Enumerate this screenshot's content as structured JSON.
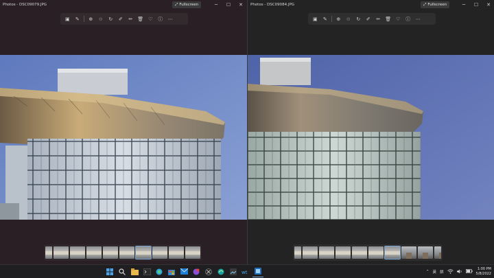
{
  "windows": [
    {
      "title": "Photos - DSC09079.JPG",
      "fullscreen_label": "Fullscreen"
    },
    {
      "title": "Photos - DSC09084.JPG",
      "fullscreen_label": "Fullscreen"
    }
  ],
  "toolbar_icons": [
    "gallery-icon",
    "edit-image-icon",
    "zoom-in-icon",
    "zoom-out-icon",
    "rotate-icon",
    "edit-icon",
    "draw-icon",
    "delete-icon",
    "favorite-icon",
    "info-icon",
    "more-icon"
  ],
  "taskbar": {
    "icons": [
      "windows-start-icon",
      "search-icon",
      "file-explorer-icon",
      "terminal-icon",
      "edge-icon",
      "store-icon",
      "mail-icon",
      "notifications-app-icon",
      "xbox-icon",
      "edge-browser-icon",
      "photos-app-icon",
      "visual-studio-code-icon",
      "photos-active-icon"
    ],
    "ime_1": "英",
    "ime_2": "拼",
    "time": "1:00 PM",
    "date": "5/8/2022"
  },
  "colors": {
    "sky_left": "#6f87c4",
    "sky_right": "#5f72b4",
    "accent": "#7aa7d4"
  }
}
